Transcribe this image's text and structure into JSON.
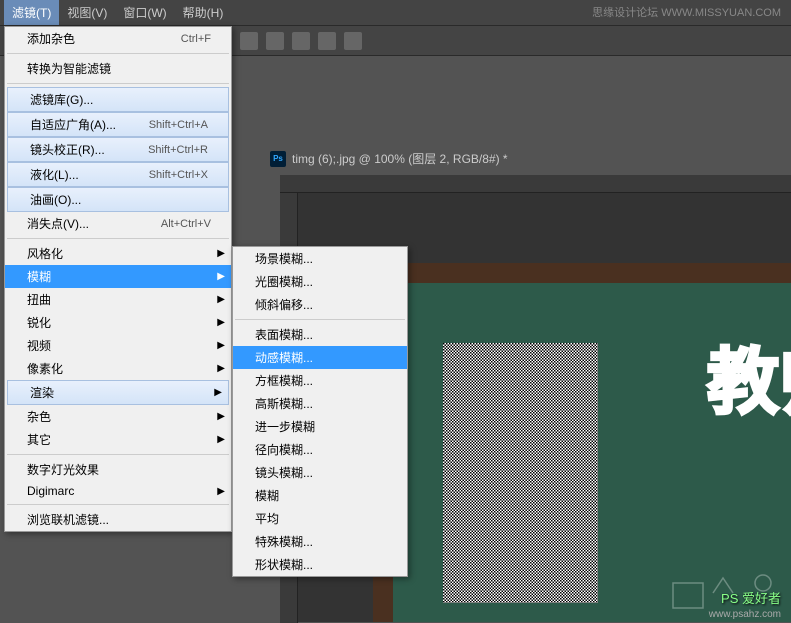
{
  "menubar": {
    "items": [
      "滤镜(T)",
      "视图(V)",
      "窗口(W)",
      "帮助(H)"
    ],
    "watermark": "思缘设计论坛  WWW.MISSYUAN.COM"
  },
  "document": {
    "ps_badge": "Ps",
    "title": "timg (6);.jpg @ 100% (图层 2, RGB/8#) *"
  },
  "dropdown1": {
    "items": [
      {
        "label": "添加杂色",
        "shortcut": "Ctrl+F",
        "type": "normal"
      },
      {
        "type": "sep"
      },
      {
        "label": "转换为智能滤镜",
        "type": "normal"
      },
      {
        "type": "sep"
      },
      {
        "label": "滤镜库(G)...",
        "type": "grouped"
      },
      {
        "label": "自适应广角(A)...",
        "shortcut": "Shift+Ctrl+A",
        "type": "grouped"
      },
      {
        "label": "镜头校正(R)...",
        "shortcut": "Shift+Ctrl+R",
        "type": "grouped"
      },
      {
        "label": "液化(L)...",
        "shortcut": "Shift+Ctrl+X",
        "type": "grouped"
      },
      {
        "label": "油画(O)...",
        "type": "grouped"
      },
      {
        "label": "消失点(V)...",
        "shortcut": "Alt+Ctrl+V",
        "type": "normal"
      },
      {
        "type": "sep"
      },
      {
        "label": "风格化",
        "type": "normal",
        "arrow": true
      },
      {
        "label": "模糊",
        "type": "highlighted",
        "arrow": true
      },
      {
        "label": "扭曲",
        "type": "normal",
        "arrow": true
      },
      {
        "label": "锐化",
        "type": "normal",
        "arrow": true
      },
      {
        "label": "视频",
        "type": "normal",
        "arrow": true
      },
      {
        "label": "像素化",
        "type": "normal",
        "arrow": true
      },
      {
        "label": "渲染",
        "type": "grouped",
        "arrow": true
      },
      {
        "label": "杂色",
        "type": "normal",
        "arrow": true
      },
      {
        "label": "其它",
        "type": "normal",
        "arrow": true
      },
      {
        "type": "sep"
      },
      {
        "label": "数字灯光效果",
        "type": "normal"
      },
      {
        "label": "Digimarc",
        "type": "normal",
        "arrow": true
      },
      {
        "type": "sep"
      },
      {
        "label": "浏览联机滤镜...",
        "type": "normal"
      }
    ]
  },
  "dropdown2": {
    "items": [
      {
        "label": "场景模糊...",
        "type": "normal"
      },
      {
        "label": "光圈模糊...",
        "type": "normal"
      },
      {
        "label": "倾斜偏移...",
        "type": "normal"
      },
      {
        "type": "sep"
      },
      {
        "label": "表面模糊...",
        "type": "normal"
      },
      {
        "label": "动感模糊...",
        "type": "highlighted"
      },
      {
        "label": "方框模糊...",
        "type": "normal"
      },
      {
        "label": "高斯模糊...",
        "type": "normal"
      },
      {
        "label": "进一步模糊",
        "type": "normal"
      },
      {
        "label": "径向模糊...",
        "type": "normal"
      },
      {
        "label": "镜头模糊...",
        "type": "normal"
      },
      {
        "label": "模糊",
        "type": "normal"
      },
      {
        "label": "平均",
        "type": "normal"
      },
      {
        "label": "特殊模糊...",
        "type": "normal"
      },
      {
        "label": "形状模糊...",
        "type": "normal"
      }
    ]
  },
  "canvas": {
    "chalk_text": "教师节"
  },
  "watermarks": {
    "logo": "PS 爱好者",
    "url": "www.psahz.com"
  }
}
